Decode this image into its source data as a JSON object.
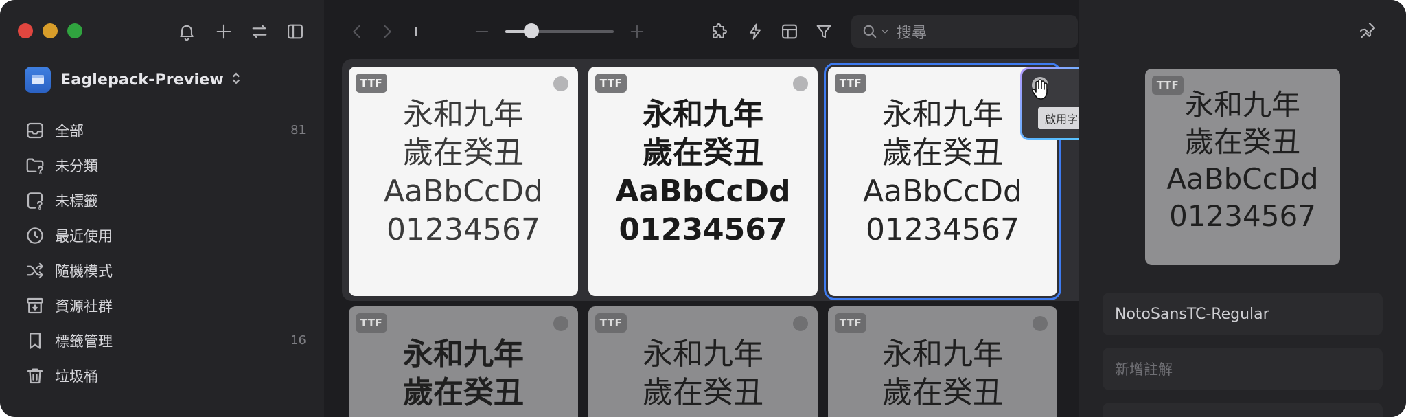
{
  "sidebar": {
    "library": {
      "name": "Eaglepack-Preview"
    },
    "items": [
      {
        "label": "全部",
        "count": "81",
        "icon": "inbox-icon"
      },
      {
        "label": "未分類",
        "count": "",
        "icon": "folder-question-icon"
      },
      {
        "label": "未標籤",
        "count": "",
        "icon": "tag-question-icon"
      },
      {
        "label": "最近使用",
        "count": "",
        "icon": "clock-icon"
      },
      {
        "label": "隨機模式",
        "count": "",
        "icon": "shuffle-icon"
      },
      {
        "label": "資源社群",
        "count": "",
        "icon": "archive-icon"
      },
      {
        "label": "標籤管理",
        "count": "16",
        "icon": "bookmark-icon"
      },
      {
        "label": "垃圾桶",
        "count": "",
        "icon": "trash-icon"
      }
    ]
  },
  "toolbar": {
    "search_placeholder": "搜尋",
    "zoom_level": 0.24
  },
  "samples": {
    "line1": "永和九年",
    "line2": "歲在癸丑",
    "line3": "AaBbCcDd",
    "line4": "01234567"
  },
  "cards": [
    {
      "badge": "TTF",
      "weight": "thin"
    },
    {
      "badge": "TTF",
      "weight": "bold"
    },
    {
      "badge": "TTF",
      "weight": "reg",
      "selected": true
    },
    {
      "badge": "TTF",
      "weight": "bold"
    },
    {
      "badge": "TTF",
      "weight": "thin"
    },
    {
      "badge": "TTF",
      "weight": "thin"
    }
  ],
  "tooltip": {
    "label": "啟用字體"
  },
  "inspector": {
    "preview_badge": "TTF",
    "font_name": "NotoSansTC-Regular",
    "note_placeholder": "新增註解"
  },
  "colors": {
    "accent": "#3e7bf0",
    "traffic_red": "#e0463f",
    "traffic_yellow": "#d89d2a",
    "traffic_green": "#30a33f"
  }
}
